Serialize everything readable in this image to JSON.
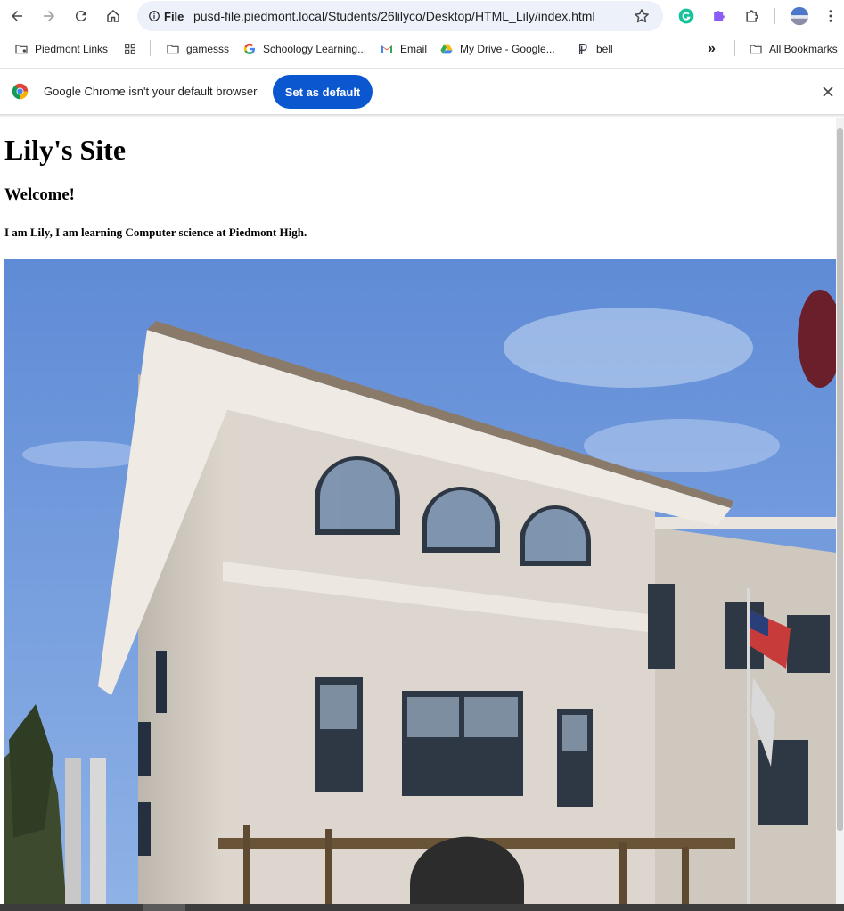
{
  "browser": {
    "site_chip": "File",
    "url": "pusd-file.piedmont.local/Students/26lilyco/Desktop/HTML_Lily/index.html"
  },
  "bookmarks": {
    "items": [
      {
        "label": "Piedmont Links",
        "icon": "folder-gear-icon"
      },
      {
        "label": "",
        "icon": "apps-grid-icon"
      },
      {
        "label": "gamesss",
        "icon": "folder-icon"
      },
      {
        "label": "Schoology Learning...",
        "icon": "google-icon"
      },
      {
        "label": "Email",
        "icon": "gmail-icon"
      },
      {
        "label": "My Drive - Google...",
        "icon": "google-drive-icon"
      },
      {
        "label": "bell",
        "icon": "bell-p-icon"
      }
    ],
    "overflow": "»",
    "all_bookmarks": "All Bookmarks"
  },
  "infobar": {
    "message": "Google Chrome isn't your default browser",
    "button": "Set as default"
  },
  "page": {
    "title": "Lily's Site",
    "heading": "Welcome!",
    "intro": "I am Lily, I am learning Computer science at Piedmont High."
  },
  "colors": {
    "accent": "#0b57d0",
    "omnibox": "#edf2fa",
    "sky": "#6f97d9",
    "building": "#d8d2c9"
  }
}
